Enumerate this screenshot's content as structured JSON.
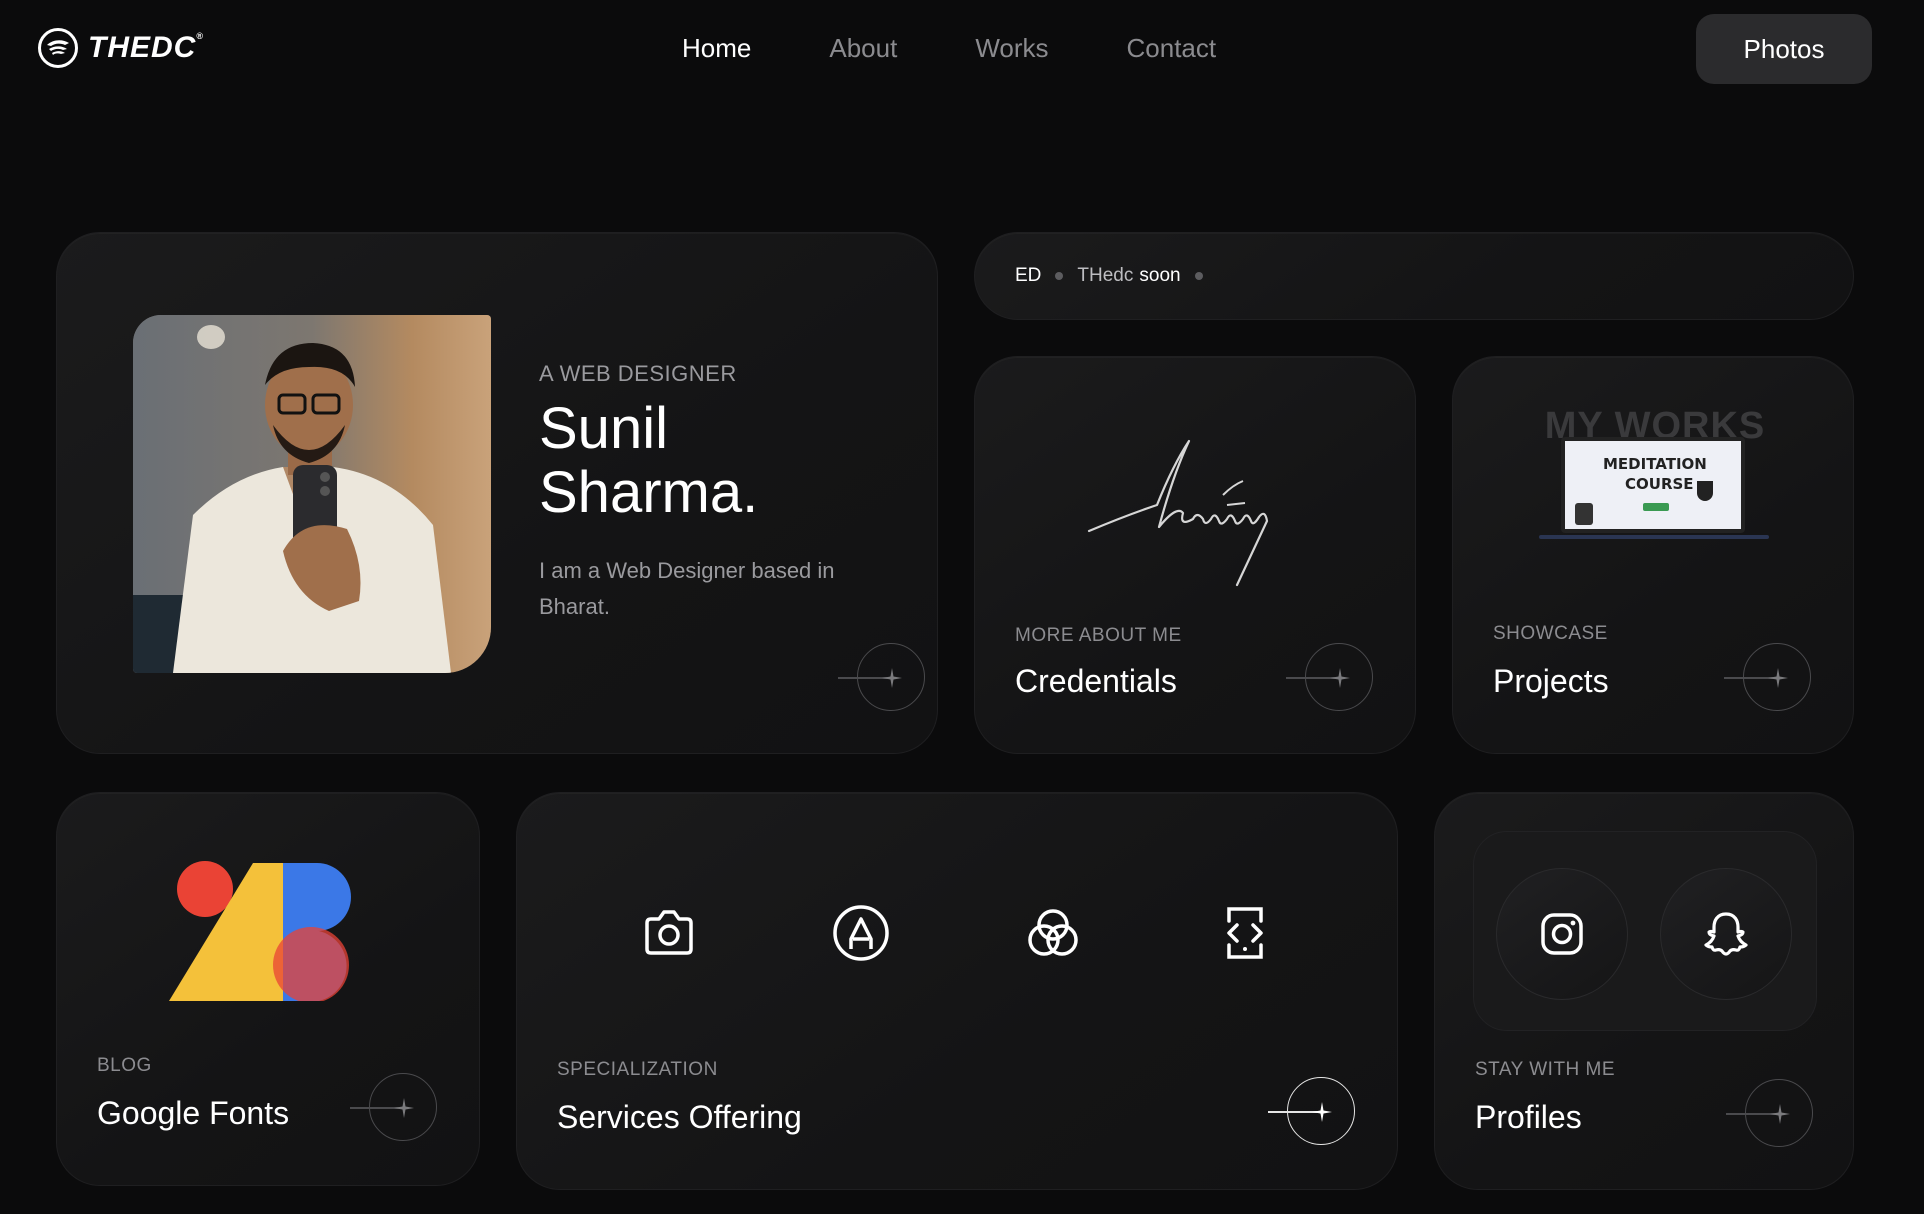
{
  "brand": {
    "name": "THEDC",
    "mark": "®"
  },
  "nav": {
    "items": [
      {
        "label": "Home",
        "active": true
      },
      {
        "label": "About",
        "active": false
      },
      {
        "label": "Works",
        "active": false
      },
      {
        "label": "Contact",
        "active": false
      }
    ],
    "cta_label": "Photos"
  },
  "hero": {
    "eyebrow": "A WEB DESIGNER",
    "name_line1": "Sunil",
    "name_line2": "Sharma.",
    "description": "I am a Web Designer based in Bharat."
  },
  "ticker": {
    "item1": "ED",
    "item2": "THedc",
    "item3": "soon"
  },
  "credentials": {
    "eyebrow": "MORE ABOUT ME",
    "title": "Credentials"
  },
  "projects": {
    "eyebrow": "SHOWCASE",
    "title": "Projects",
    "image_heading": "MY WORKS",
    "screen_line1": "MEDITATION",
    "screen_line2": "COURSE"
  },
  "fonts_card": {
    "eyebrow": "BLOG",
    "title": "Google Fonts"
  },
  "services": {
    "eyebrow": "SPECIALIZATION",
    "title": "Services Offering",
    "icons": [
      "camera-icon",
      "pen-tool-icon",
      "color-circles-icon",
      "code-device-icon"
    ]
  },
  "profiles": {
    "eyebrow": "STAY WITH ME",
    "title": "Profiles",
    "icons": [
      "instagram-icon",
      "snapchat-icon"
    ]
  },
  "colors": {
    "background": "#0b0b0c",
    "card": "#161617",
    "text_muted": "#8c8c90",
    "button": "#2b2b2d",
    "fonts_red": "#ea4335",
    "fonts_yellow": "#f4c13a",
    "fonts_blue": "#3b78e7"
  }
}
